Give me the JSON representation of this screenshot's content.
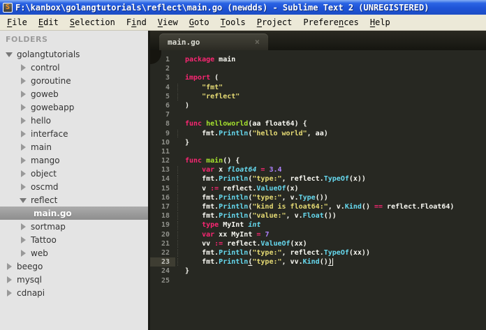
{
  "window": {
    "title": "F:\\kanbox\\golangtutorials\\reflect\\main.go (newdds) - Sublime Text 2 (UNREGISTERED)",
    "app_icon_glyph": "S"
  },
  "menu": {
    "items": [
      {
        "label": "File",
        "u": 0
      },
      {
        "label": "Edit",
        "u": 0
      },
      {
        "label": "Selection",
        "u": 0
      },
      {
        "label": "Find",
        "u": 1
      },
      {
        "label": "View",
        "u": 0
      },
      {
        "label": "Goto",
        "u": 0
      },
      {
        "label": "Tools",
        "u": 0
      },
      {
        "label": "Project",
        "u": 0
      },
      {
        "label": "Preferences",
        "u": 7
      },
      {
        "label": "Help",
        "u": 0
      }
    ]
  },
  "sidebar": {
    "header": "FOLDERS",
    "items": [
      {
        "label": "golangtutorials",
        "level": 0,
        "arrow": "down",
        "type": "folder"
      },
      {
        "label": "control",
        "level": 1,
        "arrow": "right",
        "type": "folder"
      },
      {
        "label": "goroutine",
        "level": 1,
        "arrow": "right",
        "type": "folder"
      },
      {
        "label": "goweb",
        "level": 1,
        "arrow": "right",
        "type": "folder"
      },
      {
        "label": "gowebapp",
        "level": 1,
        "arrow": "right",
        "type": "folder"
      },
      {
        "label": "hello",
        "level": 1,
        "arrow": "right",
        "type": "folder"
      },
      {
        "label": "interface",
        "level": 1,
        "arrow": "right",
        "type": "folder"
      },
      {
        "label": "main",
        "level": 1,
        "arrow": "right",
        "type": "folder"
      },
      {
        "label": "mango",
        "level": 1,
        "arrow": "right",
        "type": "folder"
      },
      {
        "label": "object",
        "level": 1,
        "arrow": "right",
        "type": "folder"
      },
      {
        "label": "oscmd",
        "level": 1,
        "arrow": "right",
        "type": "folder"
      },
      {
        "label": "reflect",
        "level": 1,
        "arrow": "down",
        "type": "folder"
      },
      {
        "label": "main.go",
        "level": 2,
        "arrow": null,
        "type": "file",
        "selected": true
      },
      {
        "label": "sortmap",
        "level": 1,
        "arrow": "right",
        "type": "folder"
      },
      {
        "label": "Tattoo",
        "level": 1,
        "arrow": "right",
        "type": "folder"
      },
      {
        "label": "web",
        "level": 1,
        "arrow": "right",
        "type": "folder"
      },
      {
        "label": "beego",
        "level": 0,
        "arrow": "right",
        "type": "folder"
      },
      {
        "label": "mysql",
        "level": 0,
        "arrow": "right",
        "type": "folder"
      },
      {
        "label": "cdnapi",
        "level": 0,
        "arrow": "right",
        "type": "folder"
      }
    ]
  },
  "tabs": [
    {
      "label": "main.go",
      "close_glyph": "×",
      "active": true
    }
  ],
  "editor": {
    "current_line": 23,
    "cursor_line": 23,
    "lines": [
      {
        "tokens": [
          [
            "k",
            "package"
          ],
          [
            "p",
            " main"
          ]
        ]
      },
      {
        "tokens": []
      },
      {
        "tokens": [
          [
            "k",
            "import"
          ],
          [
            "p",
            " ("
          ]
        ]
      },
      {
        "tokens": [
          [
            "p",
            "    "
          ],
          [
            "s",
            "\"fmt\""
          ]
        ]
      },
      {
        "tokens": [
          [
            "p",
            "    "
          ],
          [
            "s",
            "\"reflect\""
          ]
        ]
      },
      {
        "tokens": [
          [
            "p",
            ")"
          ]
        ]
      },
      {
        "tokens": []
      },
      {
        "tokens": [
          [
            "k",
            "func"
          ],
          [
            "p",
            " "
          ],
          [
            "fn",
            "helloworld"
          ],
          [
            "p",
            "(aa float64) {"
          ]
        ]
      },
      {
        "tokens": [
          [
            "p",
            "    fmt."
          ],
          [
            "c",
            "Println"
          ],
          [
            "p",
            "("
          ],
          [
            "s",
            "\"hello world\""
          ],
          [
            "p",
            ", aa)"
          ]
        ]
      },
      {
        "tokens": [
          [
            "p",
            "}"
          ]
        ]
      },
      {
        "tokens": []
      },
      {
        "tokens": [
          [
            "k",
            "func"
          ],
          [
            "p",
            " "
          ],
          [
            "fn",
            "main"
          ],
          [
            "p",
            "() {"
          ]
        ]
      },
      {
        "tokens": [
          [
            "p",
            "    "
          ],
          [
            "k",
            "var"
          ],
          [
            "p",
            " x "
          ],
          [
            "ci",
            "float64"
          ],
          [
            "p",
            " "
          ],
          [
            "k",
            "="
          ],
          [
            "p",
            " "
          ],
          [
            "n",
            "3.4"
          ]
        ]
      },
      {
        "tokens": [
          [
            "p",
            "    fmt."
          ],
          [
            "c",
            "Println"
          ],
          [
            "p",
            "("
          ],
          [
            "s",
            "\"type:\""
          ],
          [
            "p",
            ", reflect."
          ],
          [
            "c",
            "TypeOf"
          ],
          [
            "p",
            "(x))"
          ]
        ]
      },
      {
        "tokens": [
          [
            "p",
            "    v "
          ],
          [
            "k",
            ":="
          ],
          [
            "p",
            " reflect."
          ],
          [
            "c",
            "ValueOf"
          ],
          [
            "p",
            "(x)"
          ]
        ]
      },
      {
        "tokens": [
          [
            "p",
            "    fmt."
          ],
          [
            "c",
            "Println"
          ],
          [
            "p",
            "("
          ],
          [
            "s",
            "\"type:\""
          ],
          [
            "p",
            ", v."
          ],
          [
            "c",
            "Type"
          ],
          [
            "p",
            "())"
          ]
        ]
      },
      {
        "tokens": [
          [
            "p",
            "    fmt."
          ],
          [
            "c",
            "Println"
          ],
          [
            "p",
            "("
          ],
          [
            "s",
            "\"kind is float64:\""
          ],
          [
            "p",
            ", v."
          ],
          [
            "c",
            "Kind"
          ],
          [
            "p",
            "() "
          ],
          [
            "k",
            "=="
          ],
          [
            "p",
            " reflect.Float64)"
          ]
        ]
      },
      {
        "tokens": [
          [
            "p",
            "    fmt."
          ],
          [
            "c",
            "Println"
          ],
          [
            "p",
            "("
          ],
          [
            "s",
            "\"value:\""
          ],
          [
            "p",
            ", v."
          ],
          [
            "c",
            "Float"
          ],
          [
            "p",
            "())"
          ]
        ]
      },
      {
        "tokens": [
          [
            "p",
            "    "
          ],
          [
            "k",
            "type"
          ],
          [
            "p",
            " MyInt "
          ],
          [
            "ci",
            "int"
          ]
        ]
      },
      {
        "tokens": [
          [
            "p",
            "    "
          ],
          [
            "k",
            "var"
          ],
          [
            "p",
            " xx MyInt "
          ],
          [
            "k",
            "="
          ],
          [
            "p",
            " "
          ],
          [
            "n",
            "7"
          ]
        ]
      },
      {
        "tokens": [
          [
            "p",
            "    vv "
          ],
          [
            "k",
            ":="
          ],
          [
            "p",
            " reflect."
          ],
          [
            "c",
            "ValueOf"
          ],
          [
            "p",
            "(xx)"
          ]
        ]
      },
      {
        "tokens": [
          [
            "p",
            "    fmt."
          ],
          [
            "c",
            "Println"
          ],
          [
            "p",
            "("
          ],
          [
            "s",
            "\"type:\""
          ],
          [
            "p",
            ", reflect."
          ],
          [
            "c",
            "TypeOf"
          ],
          [
            "p",
            "(xx))"
          ]
        ]
      },
      {
        "tokens": [
          [
            "p",
            "    fmt."
          ],
          [
            "c",
            "Println"
          ],
          [
            "u",
            "("
          ],
          [
            "s",
            "\"type:\""
          ],
          [
            "p",
            ", vv."
          ],
          [
            "c",
            "Kind"
          ],
          [
            "p",
            "()"
          ],
          [
            "u",
            ")"
          ]
        ]
      },
      {
        "tokens": [
          [
            "p",
            "}"
          ]
        ]
      },
      {
        "tokens": []
      }
    ]
  },
  "colors": {
    "titlebar_blue": "#1e53d6",
    "menubar_bg": "#ece9d8",
    "sidebar_bg": "#e4e4e4",
    "sidebar_selected": "#989898",
    "editor_bg": "#272822",
    "keyword": "#f92672",
    "string": "#e6db74",
    "function_name": "#a6e22e",
    "call_and_type": "#66d9ef",
    "number": "#ae81ff",
    "plain": "#f8f8f2",
    "line_number": "#8f908a",
    "gutter_highlight": "#3e3d32"
  }
}
